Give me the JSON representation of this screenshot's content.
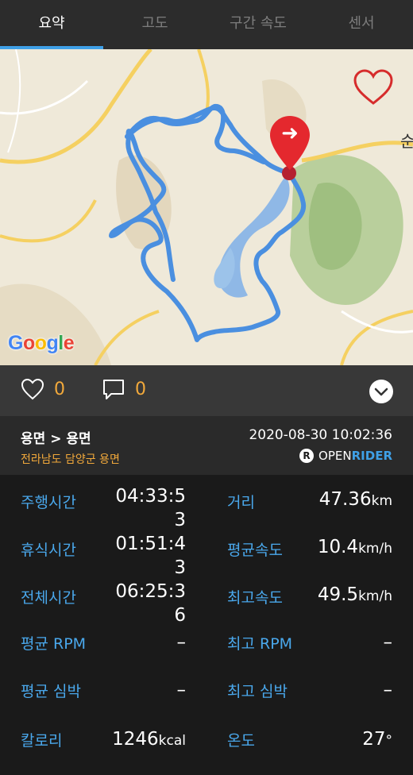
{
  "tabs": [
    {
      "label": "요약"
    },
    {
      "label": "고도"
    },
    {
      "label": "구간 속도"
    },
    {
      "label": "센서"
    }
  ],
  "map": {
    "provider_logo": "Google",
    "place_label": "순",
    "favorite_icon": "heart-outline-icon",
    "marker_icon": "map-pin-arrow-icon"
  },
  "social": {
    "likes": "0",
    "comments": "0"
  },
  "ride": {
    "route": "용면 > 용면",
    "region": "전라남도 담양군 용면",
    "datetime": "2020-08-30 10:02:36",
    "brand_open": "OPEN",
    "brand_rider": "RIDER",
    "brand_logo_letter": "R"
  },
  "stats": {
    "riding_time": {
      "label": "주행시간",
      "value": "04:33:5",
      "value2": "3"
    },
    "rest_time": {
      "label": "휴식시간",
      "value": "01:51:4",
      "value2": "3"
    },
    "total_time": {
      "label": "전체시간",
      "value": "06:25:3",
      "value2": "6"
    },
    "avg_rpm": {
      "label": "평균 RPM",
      "value": "–"
    },
    "avg_hr": {
      "label": "평균 심박",
      "value": "–"
    },
    "calories": {
      "label": "칼로리",
      "value": "1246",
      "unit": "kcal"
    },
    "distance": {
      "label": "거리",
      "value": "47.36",
      "unit": "km"
    },
    "avg_speed": {
      "label": "평균속도",
      "value": "10.4",
      "unit": "km/h"
    },
    "max_speed": {
      "label": "최고속도",
      "value": "49.5",
      "unit": "km/h"
    },
    "max_rpm": {
      "label": "최고 RPM",
      "value": "–"
    },
    "max_hr": {
      "label": "최고 심박",
      "value": "–"
    },
    "temperature": {
      "label": "온도",
      "value": "27",
      "unit": "°"
    }
  },
  "colors": {
    "accent_blue": "#3fa0e6",
    "accent_orange": "#f2a93b",
    "route_line": "#4a8fe0",
    "marker_red": "#e4282e"
  }
}
